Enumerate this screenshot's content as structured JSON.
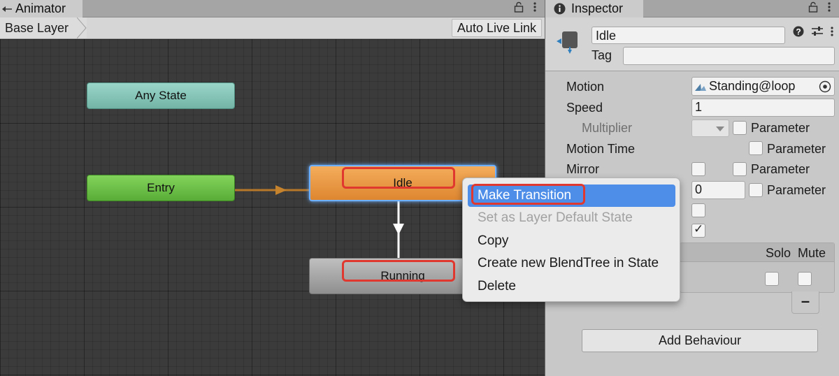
{
  "animator": {
    "tab_title": "Animator",
    "breadcrumb": "Base Layer",
    "auto_live_link": "Auto Live Link",
    "nodes": {
      "any_state": "Any State",
      "entry": "Entry",
      "idle": "Idle",
      "running": "Running"
    },
    "colors": {
      "any_state": "#86c5b7",
      "entry": "#6cc14a",
      "idle": "#eb9a45",
      "running": "#a8a8a8",
      "highlight": "#e0382e",
      "selection": "#6db0ff"
    }
  },
  "context_menu": {
    "items": [
      {
        "label": "Make Transition",
        "state": "selected"
      },
      {
        "label": "Set as Layer Default State",
        "state": "disabled"
      },
      {
        "label": "Copy",
        "state": "normal"
      },
      {
        "label": "Create new BlendTree in State",
        "state": "normal"
      },
      {
        "label": "Delete",
        "state": "normal"
      }
    ],
    "selected_color": "#4e8ee8"
  },
  "inspector": {
    "tab_title": "Inspector",
    "state_name": "Idle",
    "tag_label": "Tag",
    "tag_value": "",
    "motion": {
      "label": "Motion",
      "value": "Standing@loop"
    },
    "speed": {
      "label": "Speed",
      "value": "1"
    },
    "multiplier": {
      "label": "Multiplier",
      "param_label": "Parameter"
    },
    "motion_time": {
      "label": "Motion Time",
      "param_label": "Parameter"
    },
    "mirror": {
      "label": "Mirror",
      "param_label": "Parameter"
    },
    "cycle_offset": {
      "value": "0",
      "param_label": "Parameter"
    },
    "behaviour_table": {
      "solo": "Solo",
      "mute": "Mute"
    },
    "remove_label": "–",
    "add_behaviour": "Add Behaviour"
  }
}
